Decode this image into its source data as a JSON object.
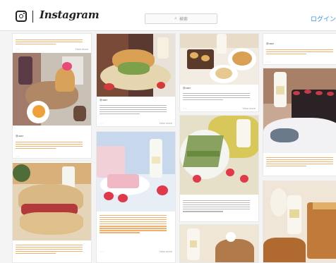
{
  "header": {
    "brand": "Instagram",
    "search_placeholder": "検索",
    "login_label": "ログイン"
  },
  "colors": {
    "link": "#3897f0",
    "caption_orange": "#e8891f"
  },
  "icons": [
    "instagram-camera-icon",
    "search-icon"
  ],
  "post_meta": {
    "view_more": "View more"
  }
}
